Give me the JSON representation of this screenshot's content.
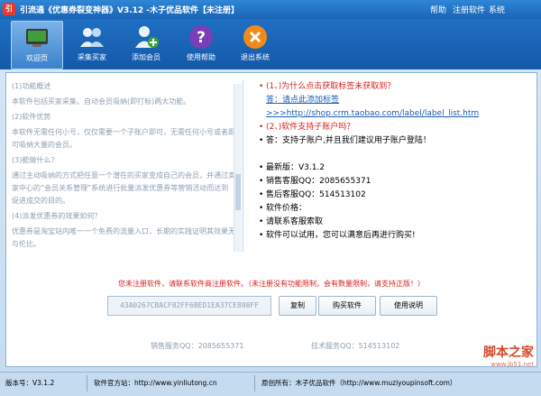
{
  "window": {
    "title": "引流通《优惠券裂变神器》V3.12 -木子优品软件【未注册】",
    "menu": [
      "帮助",
      "注册软件",
      "系统"
    ]
  },
  "toolbar": {
    "items": [
      {
        "label": "欢迎页",
        "icon": "monitor-icon"
      },
      {
        "label": "采集买家",
        "icon": "users-icon"
      },
      {
        "label": "添加会员",
        "icon": "add-user-icon"
      },
      {
        "label": "使用帮助",
        "icon": "help-icon"
      },
      {
        "label": "退出系统",
        "icon": "exit-icon"
      }
    ]
  },
  "left": {
    "paragraphs": [
      "(1)功能概述",
      "本软件包括买家采集、自动会员吸纳(即打标)两大功能。",
      "(2)软件优势",
      "本软件无需任何小号，仅仅需要一个子账户即可，无需任何小号或者即可吸纳大量的会员。",
      "(3)能做什么？",
      "通过主动吸纳的方式把任意一个潜在的买家变成自己的会员，并通过卖家中心的“会员关系管理”系统进行批量派发优惠券等营销活动而达到促进成交的目的。",
      "(4)派发优惠券的效果如何？",
      "优惠券是淘宝站内唯一一个免费的流量入口，长期的实践证明其效果无与伦比。"
    ]
  },
  "right": {
    "q1": "(1、)为什么点击获取标签未获取到？",
    "a1_label": "答：请点此添加标签",
    "a1_url": ">>>http://shop.crm.taobao.com/label/label_list.htm",
    "q2": "(2、)软件支持子账户吗？",
    "a2": "答：支持子账户,并且我们建议用子账户登陆！",
    "latest_version": "最新版：V3.1.2",
    "sales_qq": "销售客服QQ：2085655371",
    "support_qq": "售后客服QQ：514513102",
    "price_label": "软件价格：",
    "price_value": "请联系客服索取",
    "trial_note": "软件可以试用，您可以满意后再进行购买!"
  },
  "register": {
    "notice": "您未注册软件，请联系软件商注册软件。（未注册没有功能限制，会有数量限制，请支持正版！）",
    "machine_code": "43A0267CBACF82FF6BED1EA37CE898FF",
    "copy_label": "复制",
    "buy_label": "购买软件",
    "manual_label": "使用说明"
  },
  "service": {
    "sales": "销售服务QQ：2085655371",
    "tech": "技术服务QQ：514513102"
  },
  "status": {
    "version": "版本号：V3.1.2",
    "website": "软件官方站：http://www.yinliutong.cn",
    "vendor": "原创所有：木子优品软件（http://www.muziyoupinsoft.com）"
  },
  "watermark": {
    "main": "脚本之家",
    "sub": "www.jb51.net"
  }
}
